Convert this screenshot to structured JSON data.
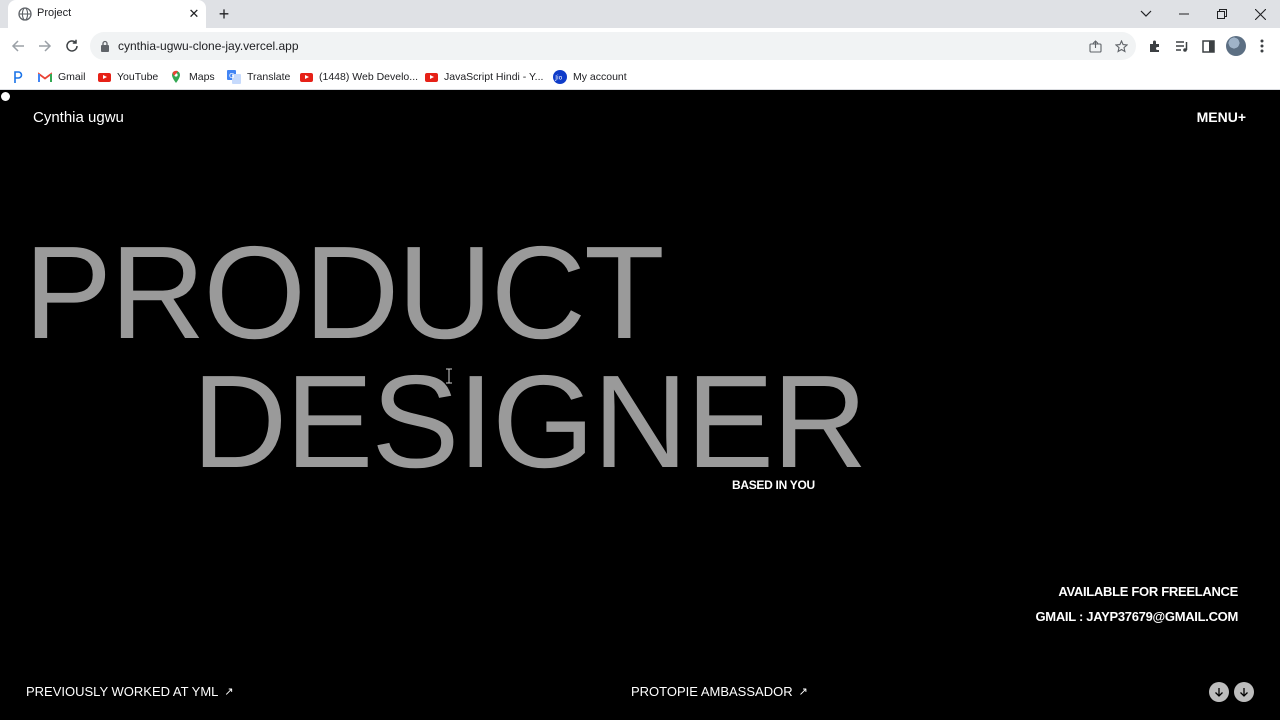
{
  "browser": {
    "tab_title": "Project",
    "url": "cynthia-ugwu-clone-jay.vercel.app",
    "bookmarks": [
      {
        "label": "Gmail",
        "icon": "gmail-icon"
      },
      {
        "label": "YouTube",
        "icon": "youtube-icon"
      },
      {
        "label": "Maps",
        "icon": "maps-icon"
      },
      {
        "label": "Translate",
        "icon": "translate-icon"
      },
      {
        "label": "(1448) Web Develo...",
        "icon": "youtube-icon"
      },
      {
        "label": "JavaScript  Hindi - Y...",
        "icon": "youtube-icon"
      },
      {
        "label": "My account",
        "icon": "jio-icon"
      }
    ]
  },
  "page": {
    "logo": "Cynthia ugwu",
    "menu": "MENU+",
    "hero_line1": "PRODUCT",
    "hero_line2": "DESIGNER",
    "based": "BASED IN YOU",
    "freelance": "AVAILABLE FOR FREELANCE",
    "gmail": "GMAIL : JAYP37679@GMAIL.COM",
    "link_left": "PREVIOUSLY WORKED AT YML",
    "link_right": "PROTOPIE AMBASSADOR",
    "link_arrow": "↗"
  },
  "colors": {
    "background": "#000000",
    "hero_text": "#9a9a9a",
    "text": "#ffffff"
  }
}
